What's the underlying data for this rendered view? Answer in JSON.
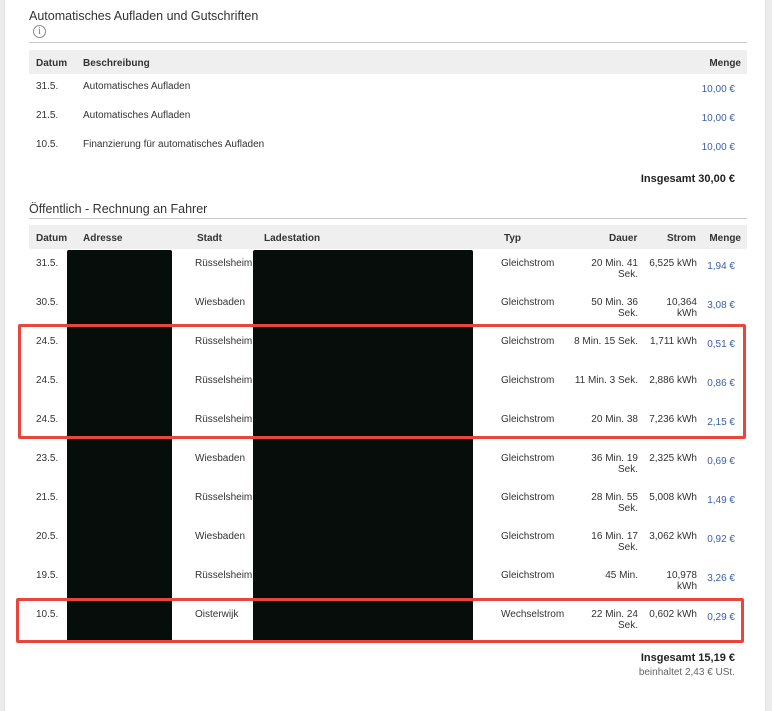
{
  "autoload": {
    "title": "Automatisches Aufladen und Gutschriften",
    "headers": {
      "datum": "Datum",
      "beschreibung": "Beschreibung",
      "menge": "Menge"
    },
    "rows": [
      {
        "datum": "31.5.",
        "beschreibung": "Automatisches Aufladen",
        "menge": "10,00 €"
      },
      {
        "datum": "21.5.",
        "beschreibung": "Automatisches Aufladen",
        "menge": "10,00 €"
      },
      {
        "datum": "10.5.",
        "beschreibung": "Finanzierung für automatisches Aufladen",
        "menge": "10,00 €"
      }
    ],
    "total": "Insgesamt 30,00 €"
  },
  "public": {
    "title": "Öffentlich - Rechnung an Fahrer",
    "headers": {
      "datum": "Datum",
      "adresse": "Adresse",
      "stadt": "Stadt",
      "ladestation": "Ladestation",
      "typ": "Typ",
      "dauer": "Dauer",
      "strom": "Strom",
      "menge": "Menge"
    },
    "rows": [
      {
        "datum": "31.5.",
        "stadt": "Rüsselsheim",
        "typ": "Gleichstrom",
        "dauer1": "20 Min. 41",
        "dauer2": "Sek.",
        "strom1": "6,525 kWh",
        "strom2": "",
        "menge": "1,94 €"
      },
      {
        "datum": "30.5.",
        "stadt": "Wiesbaden",
        "typ": "Gleichstrom",
        "dauer1": "50 Min. 36",
        "dauer2": "Sek.",
        "strom1": "10,364",
        "strom2": "kWh",
        "menge": "3,08 €"
      },
      {
        "datum": "24.5.",
        "stadt": "Rüsselsheim",
        "typ": "Gleichstrom",
        "dauer1": "8 Min. 15 Sek.",
        "dauer2": "",
        "strom1": "1,711 kWh",
        "strom2": "",
        "menge": "0,51 €"
      },
      {
        "datum": "24.5.",
        "stadt": "Rüsselsheim",
        "typ": "Gleichstrom",
        "dauer1": "11 Min. 3 Sek.",
        "dauer2": "",
        "strom1": "2,886 kWh",
        "strom2": "",
        "menge": "0,86 €"
      },
      {
        "datum": "24.5.",
        "stadt": "Rüsselsheim",
        "typ": "Gleichstrom",
        "dauer1": "20 Min. 38",
        "dauer2": "",
        "strom1": "7,236 kWh",
        "strom2": "",
        "menge": "2,15 €"
      },
      {
        "datum": "23.5.",
        "stadt": "Wiesbaden",
        "typ": "Gleichstrom",
        "dauer1": "36 Min. 19",
        "dauer2": "Sek.",
        "strom1": "2,325 kWh",
        "strom2": "",
        "menge": "0,69 €"
      },
      {
        "datum": "21.5.",
        "stadt": "Rüsselsheim",
        "typ": "Gleichstrom",
        "dauer1": "28 Min. 55",
        "dauer2": "Sek.",
        "strom1": "5,008 kWh",
        "strom2": "",
        "menge": "1,49 €"
      },
      {
        "datum": "20.5.",
        "stadt": "Wiesbaden",
        "typ": "Gleichstrom",
        "dauer1": "16 Min. 17",
        "dauer2": "Sek.",
        "strom1": "3,062 kWh",
        "strom2": "",
        "menge": "0,92 €"
      },
      {
        "datum": "19.5.",
        "stadt": "Rüsselsheim",
        "typ": "Gleichstrom",
        "dauer1": "45 Min.",
        "dauer2": "",
        "strom1": "10,978",
        "strom2": "kWh",
        "menge": "3,26 €"
      },
      {
        "datum": "10.5.",
        "stadt": "Oisterwijk",
        "typ": "Wechselstrom",
        "dauer1": "22 Min. 24",
        "dauer2": "Sek.",
        "strom1": "0,602 kWh",
        "strom2": "",
        "menge": "0,29 €"
      }
    ],
    "total": "Insgesamt 15,19 €",
    "vat": "beinhaltet 2,43 € USt."
  },
  "colors": {
    "highlight": "#e8463d",
    "money_link": "#3a5ea8",
    "redaction": "#070d0b"
  }
}
